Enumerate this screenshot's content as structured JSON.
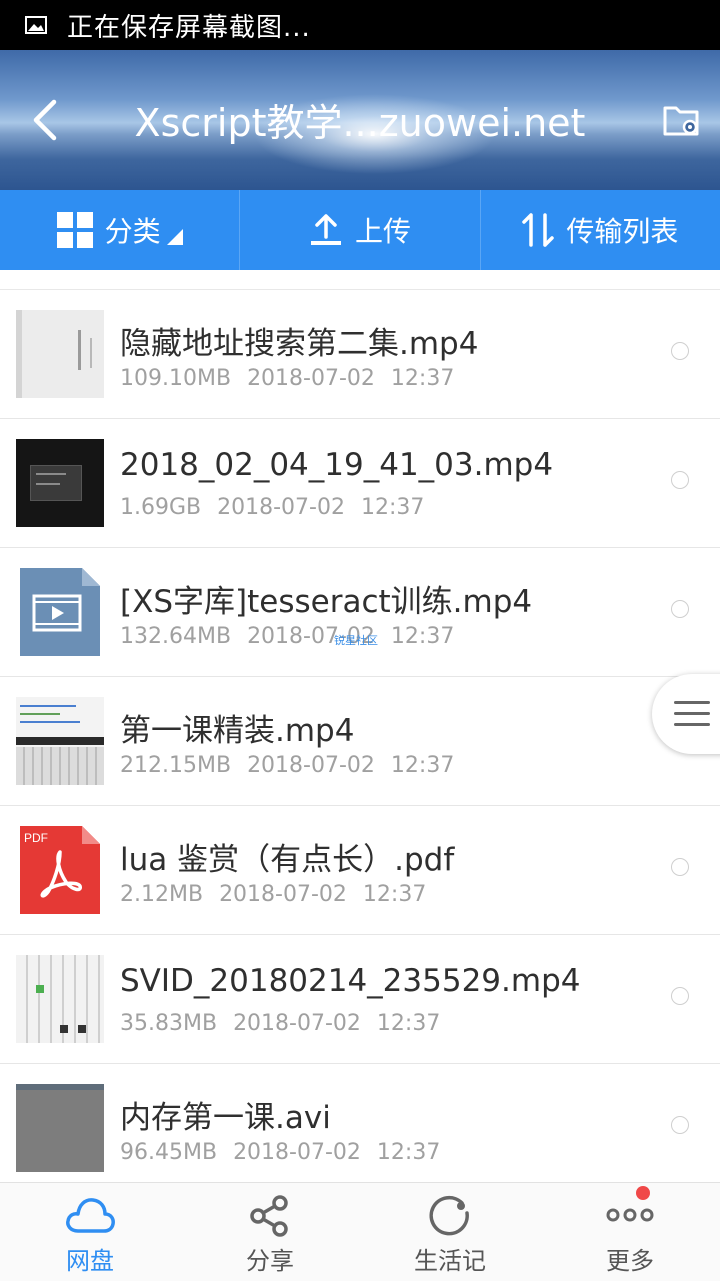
{
  "status_bar": {
    "text": "正在保存屏幕截图..."
  },
  "header": {
    "title": "Xscript教学...zuowei.net"
  },
  "toolbar": {
    "category_label": "分类",
    "upload_label": "上传",
    "transfer_label": "传输列表"
  },
  "files": [
    {
      "name": "隐藏地址搜索第二集.mp4",
      "size": "109.10MB",
      "date": "2018-07-02",
      "time": "12:37",
      "thumb": "doc-video"
    },
    {
      "name": "2018_02_04_19_41_03.mp4",
      "size": "1.69GB",
      "date": "2018-07-02",
      "time": "12:37",
      "thumb": "dark-video"
    },
    {
      "name": "[XS字库]tesseract训练.mp4",
      "size": "132.64MB",
      "date": "2018-07-02",
      "time": "12:37",
      "thumb": "video-file-icon"
    },
    {
      "name": "第一课精装.mp4",
      "size": "212.15MB",
      "date": "2018-07-02",
      "time": "12:37",
      "thumb": "keyboard-video"
    },
    {
      "name": "lua 鉴赏（有点长）.pdf",
      "size": "2.12MB",
      "date": "2018-07-02",
      "time": "12:37",
      "thumb": "pdf-icon"
    },
    {
      "name": "SVID_20180214_235529.mp4",
      "size": "35.83MB",
      "date": "2018-07-02",
      "time": "12:37",
      "thumb": "screen-video"
    },
    {
      "name": "内存第一课.avi",
      "size": "96.45MB",
      "date": "2018-07-02",
      "time": "12:37",
      "thumb": "gray-video"
    }
  ],
  "watermark": "锐星社区",
  "pdf_badge": "PDF",
  "bottom_nav": {
    "cloud": "网盘",
    "share": "分享",
    "life": "生活记",
    "more": "更多"
  },
  "colors": {
    "accent": "#2f8ef2",
    "badge": "#f04848",
    "pdf": "#e53935",
    "video_icon": "#6b8fb5"
  }
}
